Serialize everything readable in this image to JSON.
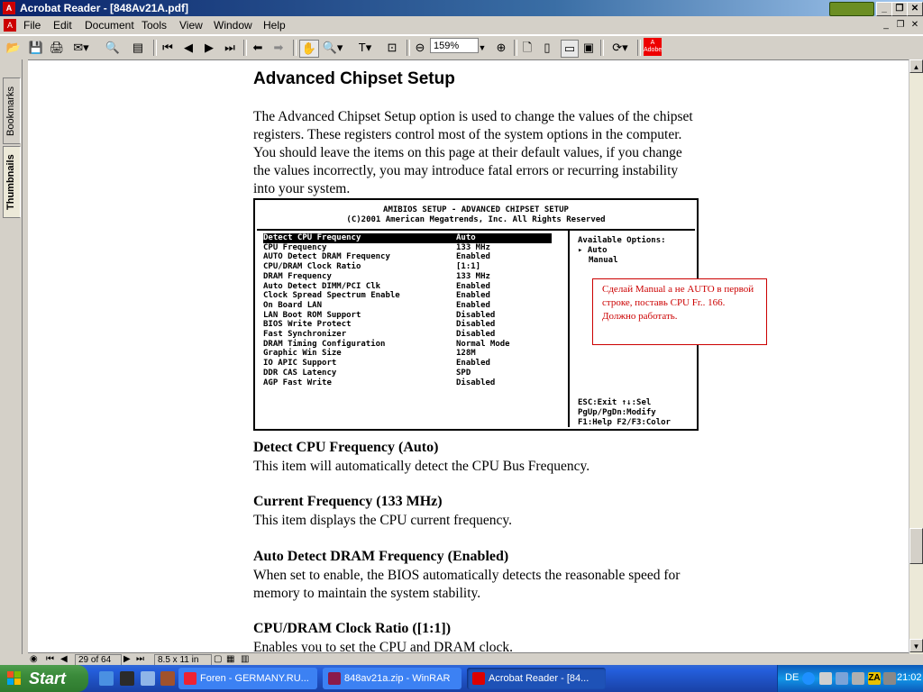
{
  "window": {
    "title": "Acrobat Reader - [848Av21A.pdf]"
  },
  "menu": [
    "File",
    "Edit",
    "Document",
    "Tools",
    "View",
    "Window",
    "Help"
  ],
  "toolbar": {
    "zoom": "159%"
  },
  "nav_tabs": {
    "bookmarks": "Bookmarks",
    "thumbnails": "Thumbnails"
  },
  "doc": {
    "heading": "Advanced Chipset Setup",
    "intro": "The Advanced Chipset Setup option is used to change the values of the chipset registers. These registers control most of the system options in the computer. You should leave the items on this page at their default values, if you change the values incorrectly, you may introduce fatal errors or recurring instability into your system.",
    "bios": {
      "header_line1": "AMIBIOS SETUP - ADVANCED CHIPSET SETUP",
      "header_line2": "(C)2001 American Megatrends, Inc. All Rights Reserved",
      "rows": [
        {
          "label": "Detect CPU Frequency",
          "value": "Auto"
        },
        {
          "label": "CPU Frequency",
          "value": "133 MHz"
        },
        {
          "label": "AUTO Detect DRAM Frequency",
          "value": "Enabled"
        },
        {
          "label": "CPU/DRAM Clock Ratio",
          "value": "[1:1]"
        },
        {
          "label": "DRAM Frequency",
          "value": "133 MHz"
        },
        {
          "label": "Auto Detect DIMM/PCI Clk",
          "value": "Enabled"
        },
        {
          "label": "Clock Spread Spectrum Enable",
          "value": "Enabled"
        },
        {
          "label": "On Board LAN",
          "value": "Enabled"
        },
        {
          "label": "LAN Boot ROM Support",
          "value": "Disabled"
        },
        {
          "label": "BIOS Write Protect",
          "value": "Disabled"
        },
        {
          "label": "Fast Synchronizer",
          "value": "Disabled"
        },
        {
          "label": "DRAM Timing Configuration",
          "value": "Normal Mode"
        },
        {
          "label": "Graphic Win Size",
          "value": "128M"
        },
        {
          "label": "IO APIC Support",
          "value": "Enabled"
        },
        {
          "label": "DDR CAS Latency",
          "value": "SPD"
        },
        {
          "label": "AGP Fast Write",
          "value": "Disabled"
        }
      ],
      "options_title": "Available Options:",
      "options": [
        "Auto",
        "Manual"
      ],
      "keys": [
        "ESC:Exit  ↑↓:Sel",
        "PgUp/PgDn:Modify",
        "F1:Help F2/F3:Color"
      ]
    },
    "annotation": "Сделай Manual а не AUTO в первой строке, поставь CPU Fr.. 166. Должно работать.",
    "sections": [
      {
        "title": "Detect CPU Frequency (Auto)",
        "text": "This item will automatically detect the CPU Bus Frequency."
      },
      {
        "title": "Current Frequency (133 MHz)",
        "text": "This item displays the CPU current frequency."
      },
      {
        "title": "Auto Detect DRAM Frequency (Enabled)",
        "text": "When set to enable, the BIOS automatically detects the reasonable speed for memory to maintain the system stability."
      },
      {
        "title": "CPU/DRAM Clock Ratio ([1:1])",
        "text": "Enables you to set the CPU and DRAM clock."
      }
    ]
  },
  "status": {
    "page": "29 of 64",
    "size": "8.5 x 11 in"
  },
  "taskbar": {
    "start": "Start",
    "tasks": [
      "Foren - GERMANY.RU...",
      "848av21a.zip - WinRAR",
      "Acrobat Reader - [84..."
    ],
    "lang": "DE",
    "clock": "21:02"
  },
  "colors": {
    "title_bar": "#0a246a",
    "taskbar": "#245edb",
    "start_button": "#3a8a3a",
    "annotation": "#cc0000"
  }
}
